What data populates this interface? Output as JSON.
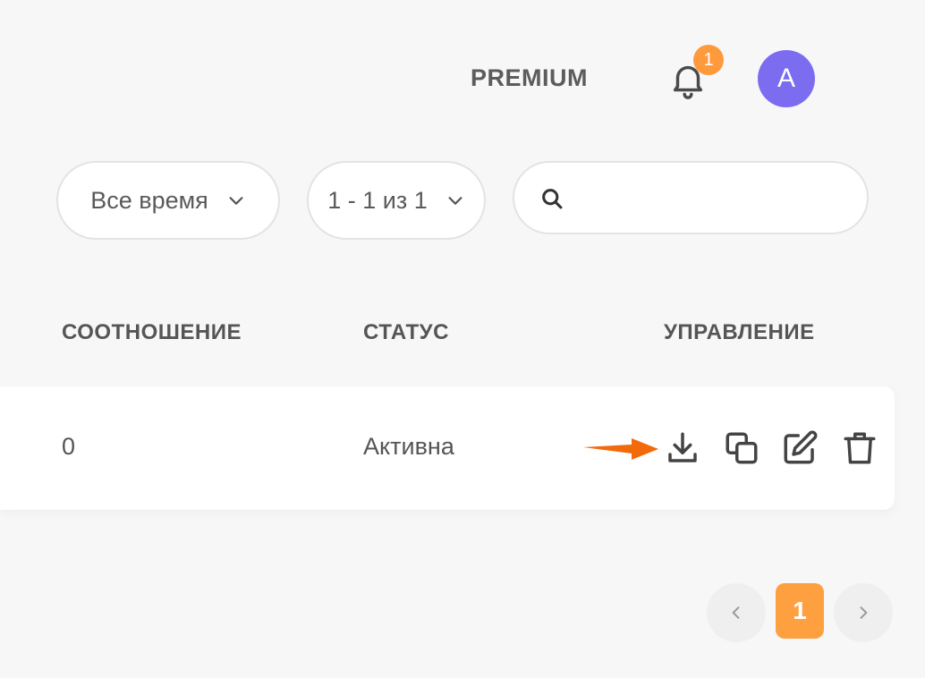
{
  "header": {
    "plan_label": "PREMIUM",
    "notifications_count": "1",
    "avatar_initial": "A"
  },
  "filters": {
    "period": "Все время",
    "pagination_range": "1 - 1 из 1",
    "search_placeholder": ""
  },
  "table": {
    "columns": [
      "СООТНОШЕНИЕ",
      "СТАТУС",
      "УПРАВЛЕНИЕ"
    ],
    "rows": [
      {
        "ratio": "0",
        "status": "Активна"
      }
    ]
  },
  "pagination": {
    "current_page": "1"
  },
  "colors": {
    "accent": "#ffa040",
    "avatar": "#7b6cf0",
    "annotation_arrow": "#f26a0a"
  },
  "icons": [
    "bell-icon",
    "chevron-down-icon",
    "search-icon",
    "download-icon",
    "copy-icon",
    "edit-icon",
    "trash-icon",
    "chevron-left-icon",
    "chevron-right-icon",
    "arrow-annotation-icon"
  ]
}
